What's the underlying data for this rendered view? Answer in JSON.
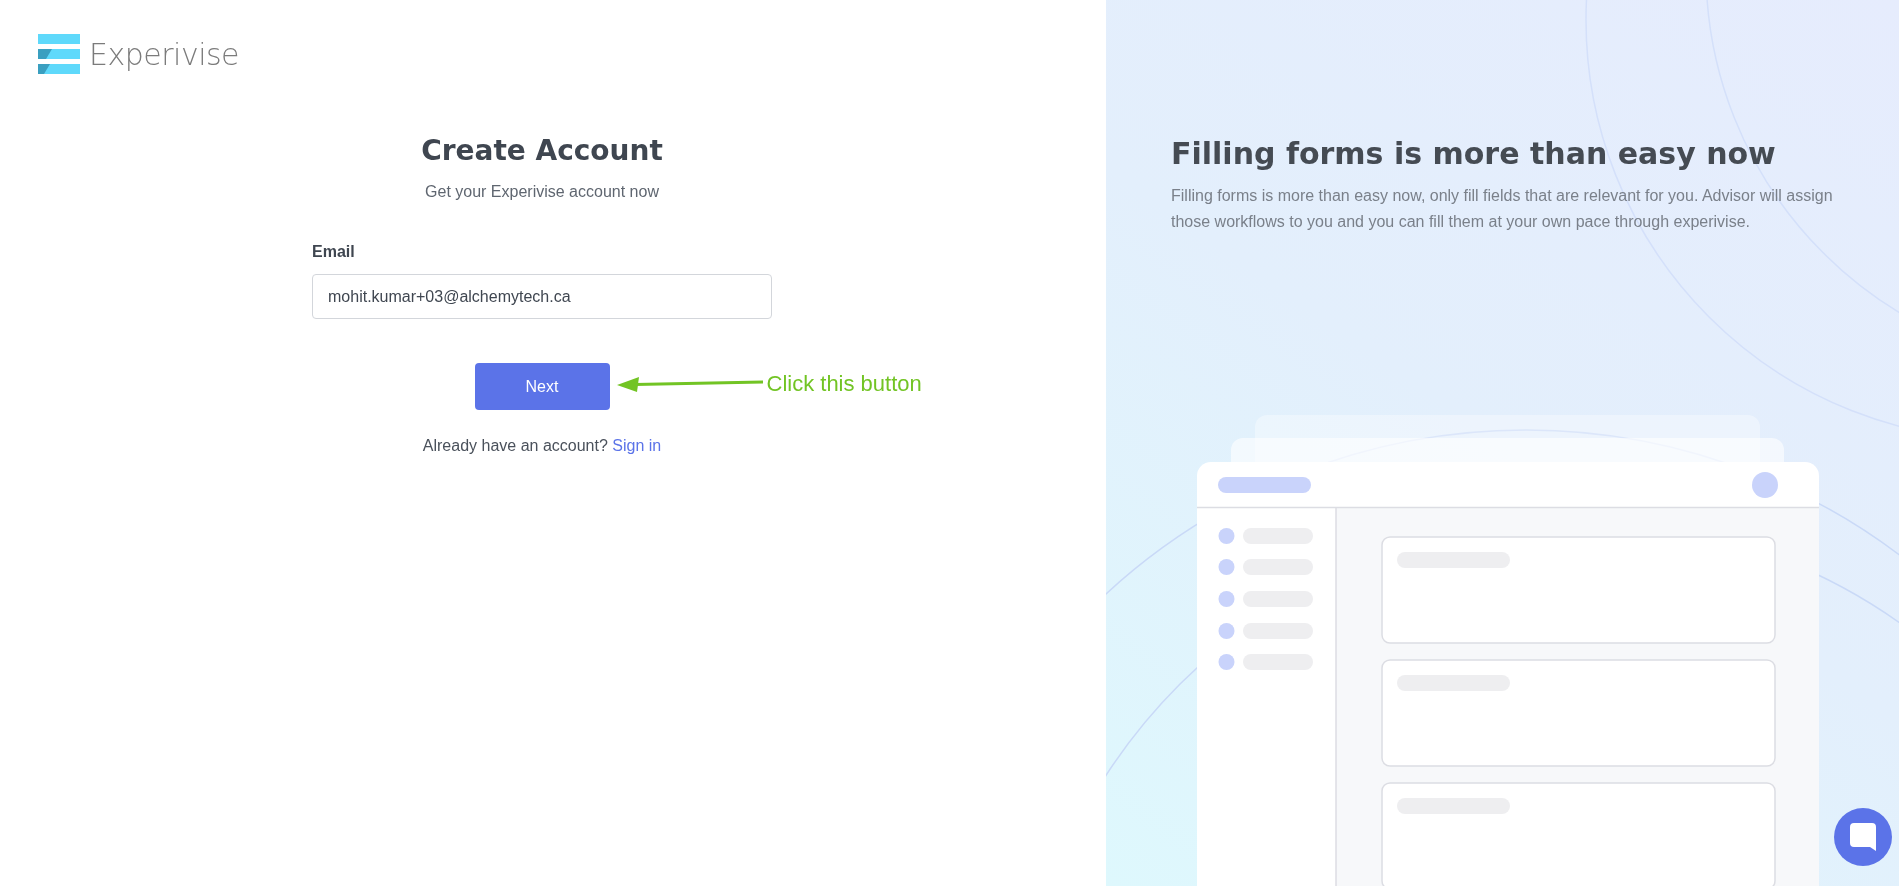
{
  "logo": {
    "text": "Experivise"
  },
  "form": {
    "title": "Create Account",
    "subtitle": "Get your Experivise account now",
    "email": {
      "label": "Email",
      "value": "mohit.kumar+03@alchemytech.ca"
    },
    "button": "Next",
    "signin_prompt": "Already have an account?",
    "signin_link": "Sign in"
  },
  "annotation": {
    "text": "Click this button"
  },
  "promo": {
    "title": "Filling forms is more than easy now",
    "text": "Filling forms is more than easy now, only fill fields that are relevant for you. Advisor will assign those workflows to you and you can fill them at your own pace through experivise."
  }
}
